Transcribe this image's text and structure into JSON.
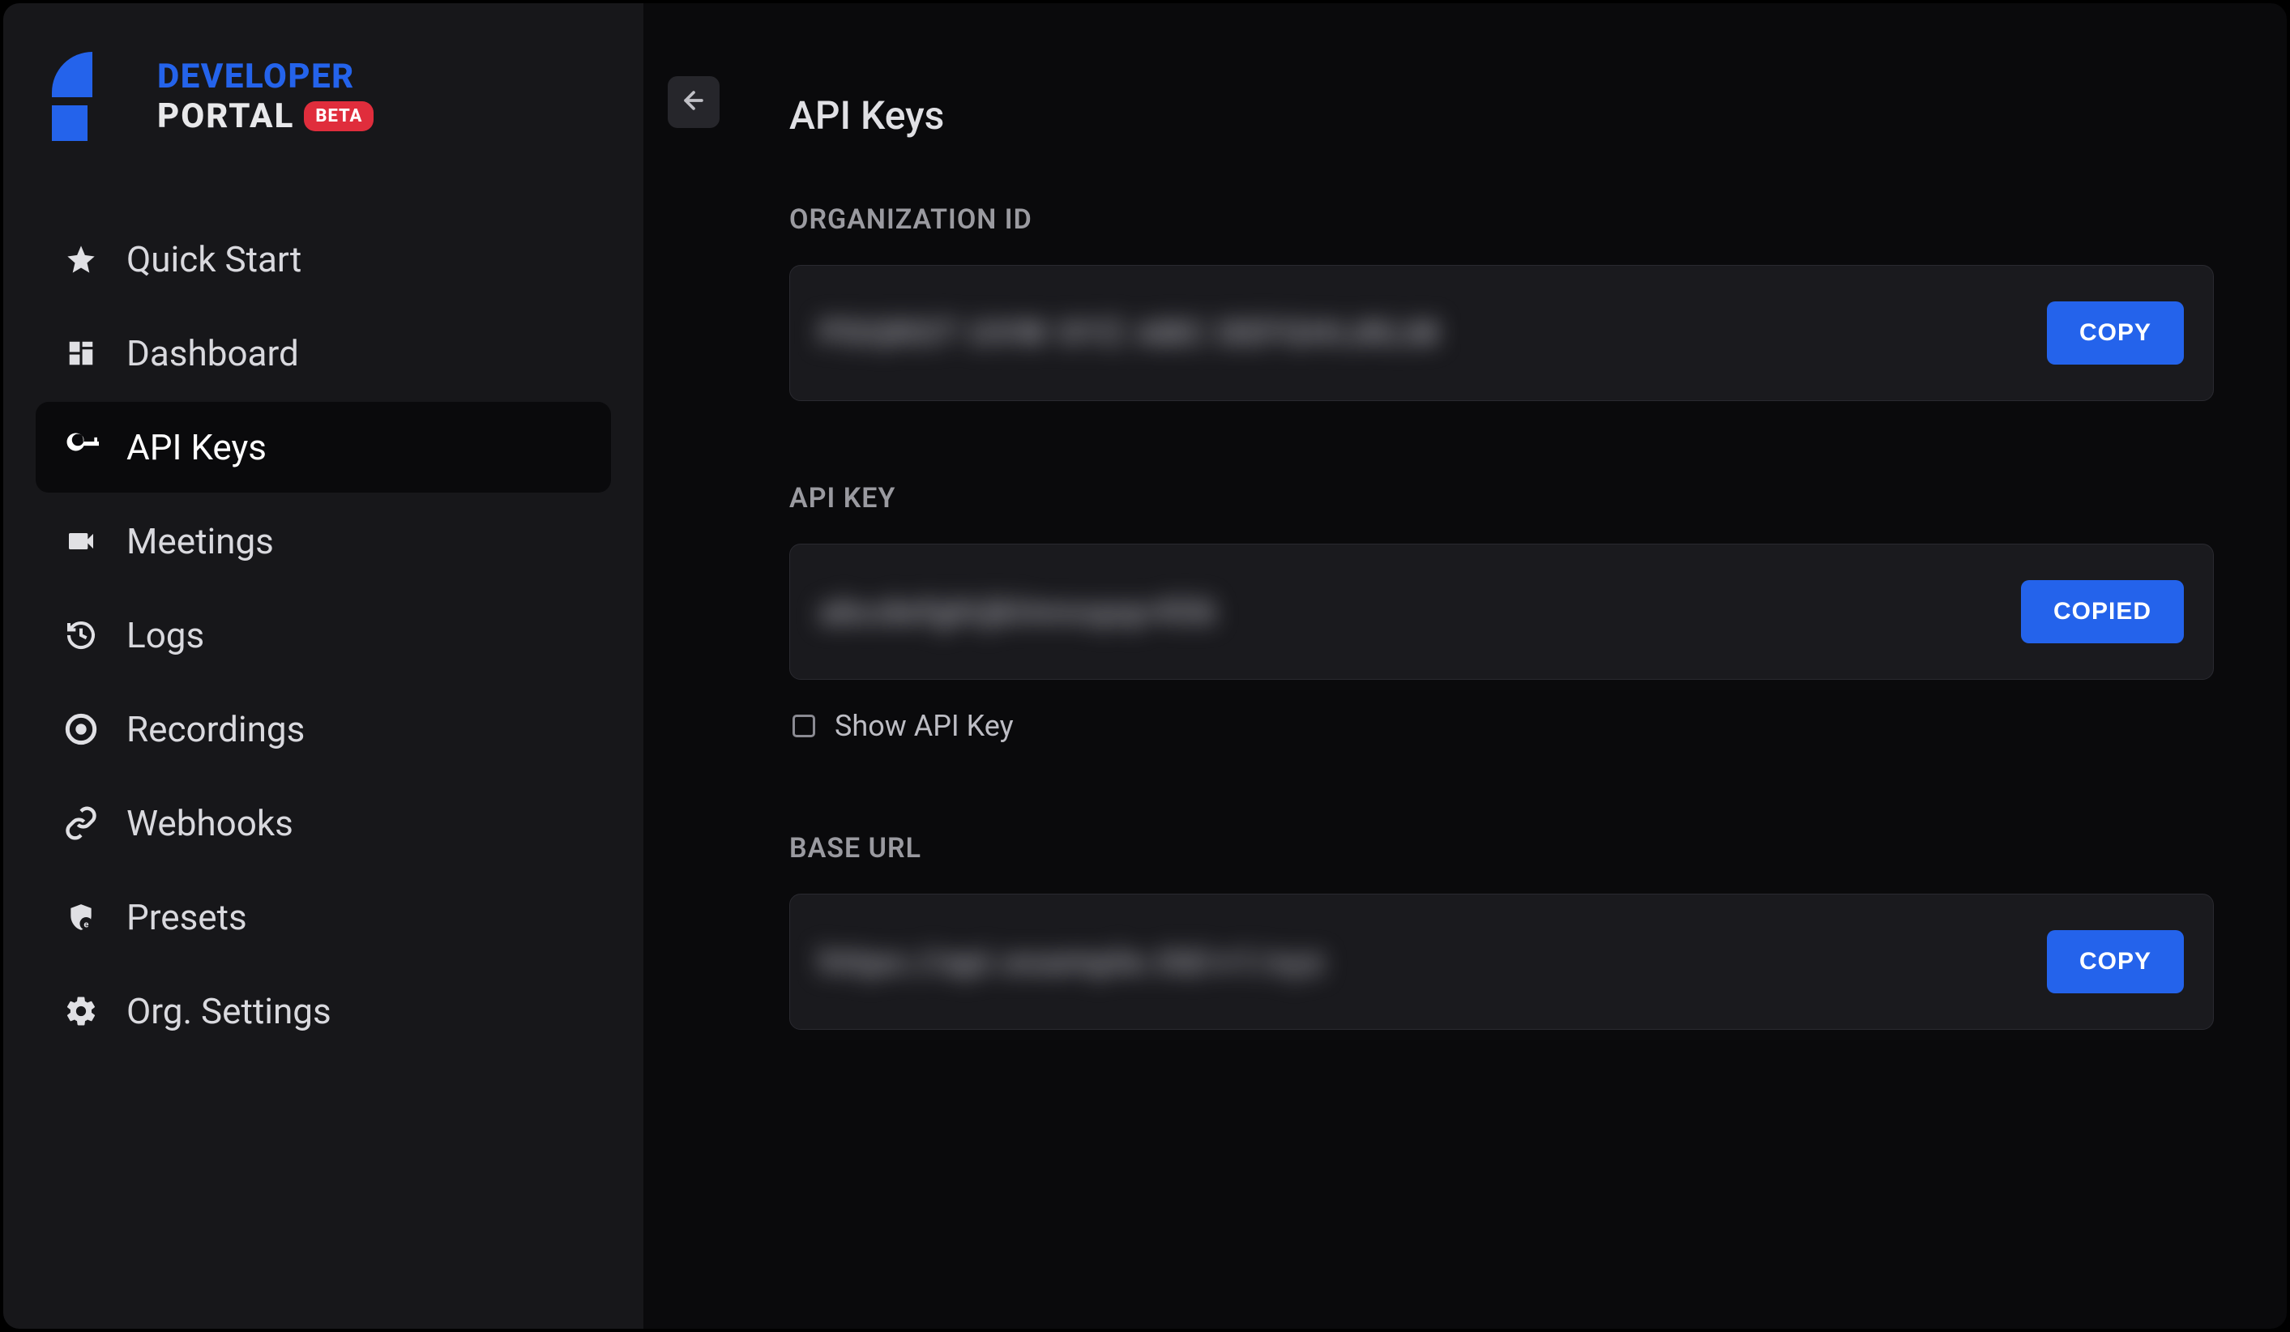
{
  "brand": {
    "line1": "DEVELOPER",
    "line2": "PORTAL",
    "badge": "BETA"
  },
  "sidebar": {
    "items": [
      {
        "icon": "star-icon",
        "label": "Quick Start",
        "active": false
      },
      {
        "icon": "dashboard-icon",
        "label": "Dashboard",
        "active": false
      },
      {
        "icon": "key-icon",
        "label": "API Keys",
        "active": true
      },
      {
        "icon": "video-icon",
        "label": "Meetings",
        "active": false
      },
      {
        "icon": "history-icon",
        "label": "Logs",
        "active": false
      },
      {
        "icon": "record-icon",
        "label": "Recordings",
        "active": false
      },
      {
        "icon": "link-icon",
        "label": "Webhooks",
        "active": false
      },
      {
        "icon": "shield-icon",
        "label": "Presets",
        "active": false
      },
      {
        "icon": "gear-icon",
        "label": "Org. Settings",
        "active": false
      }
    ]
  },
  "page": {
    "title": "API Keys",
    "org_label": "ORGANIZATION ID",
    "org_value": "PDQRST UVW XYZ ABC DEFGHIJKLM",
    "org_copy": "COPY",
    "apikey_label": "API KEY",
    "apikey_value": "abcdefghijklmnopqr456",
    "apikey_copy": "COPIED",
    "show_apikey_label": "Show API Key",
    "show_apikey_checked": false,
    "baseurl_label": "BASE URL",
    "baseurl_value": "https://api.example.tld/v1/xyz",
    "baseurl_copy": "COPY"
  }
}
